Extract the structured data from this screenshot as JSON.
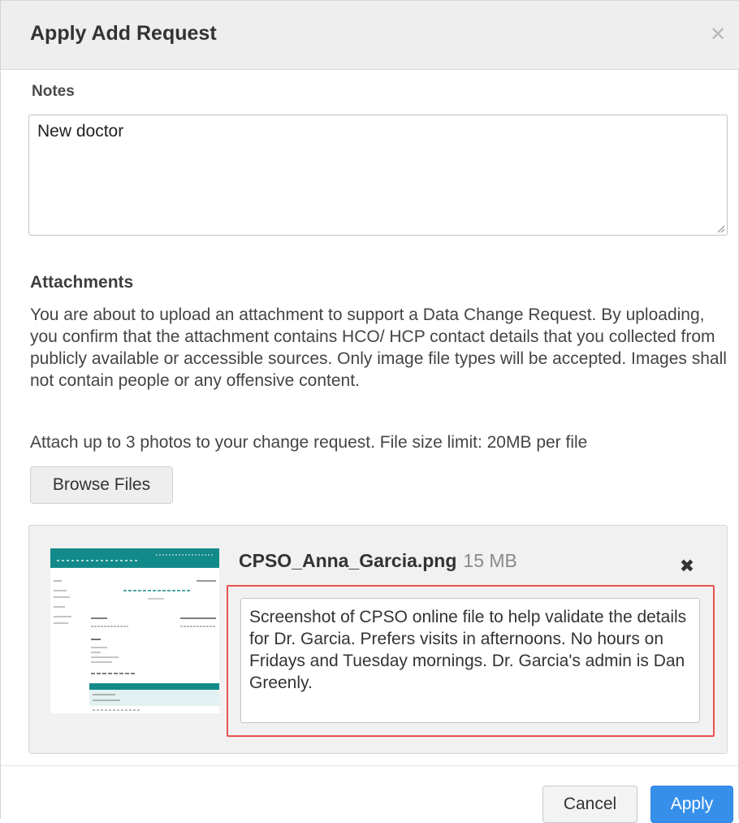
{
  "dialog": {
    "title": "Apply Add Request",
    "close_icon": "close-icon"
  },
  "notes": {
    "label": "Notes",
    "value": "New doctor"
  },
  "attachments": {
    "label": "Attachments",
    "disclaimer": "You are about to upload an attachment to support a Data Change Request. By uploading, you confirm that the attachment contains HCO/ HCP contact details that you collected from publicly available or accessible sources. Only image file types will be accepted. Images shall not contain people or any offensive content.",
    "limit_text": "Attach up to 3 photos to your change request. File size limit: 20MB per file",
    "browse_label": "Browse Files",
    "file": {
      "name": "CPSO_Anna_Garcia.png",
      "size": "15 MB",
      "description": "Screenshot of CPSO online file to help validate the details for Dr. Garcia. Prefers visits in afternoons. No hours on Fridays and Tuesday mornings. Dr. Garcia's admin is Dan Greenly.",
      "remove_icon": "remove-file-icon"
    }
  },
  "footer": {
    "cancel_label": "Cancel",
    "apply_label": "Apply"
  },
  "colors": {
    "header_bg": "#eeeeee",
    "apply_blue": "#3690ea",
    "highlight_red": "#e8524f",
    "thumb_teal": "#138a8a"
  }
}
